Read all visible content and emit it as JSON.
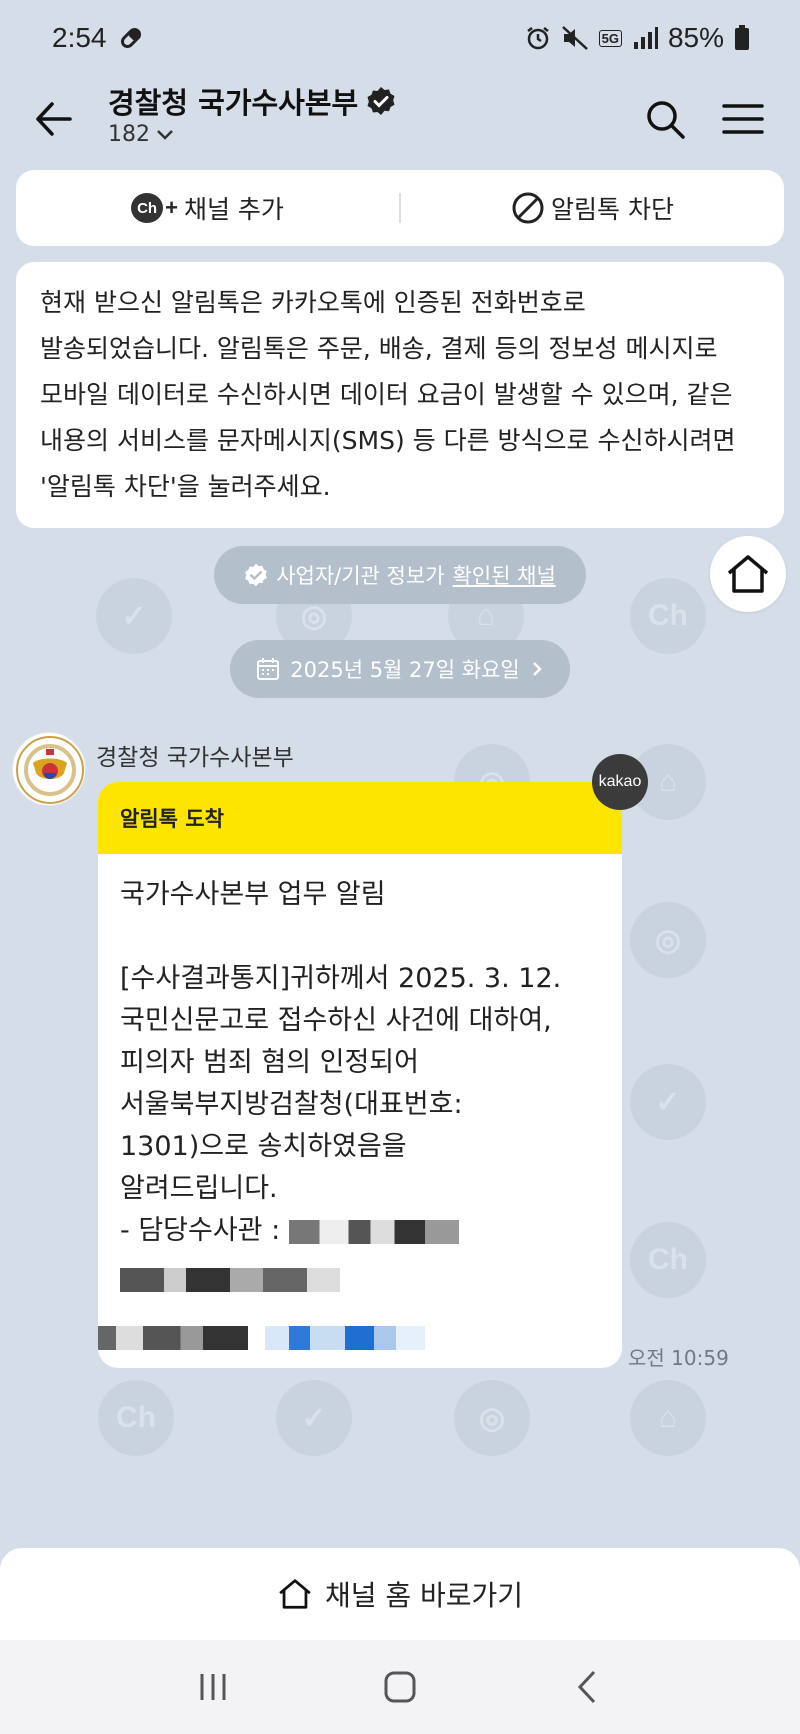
{
  "status_bar": {
    "time": "2:54",
    "battery": "85%",
    "network": "5G"
  },
  "header": {
    "title": "경찰청 국가수사본부",
    "subscriber_count": "182"
  },
  "actions": {
    "add_channel": "채널 추가",
    "add_channel_badge": "Ch",
    "block": "알림톡 차단"
  },
  "notice": {
    "text": "현재 받으신 알림톡은 카카오톡에 인증된 전화번호로 발송되었습니다. 알림톡은 주문, 배송, 결제 등의 정보성 메시지로 모바일 데이터로 수신하시면 데이터 요금이 발생할 수 있으며, 같은 내용의 서비스를 문자메시지(SMS) 등 다른 방식으로 수신하시려면 '알림톡 차단'을 눌러주세요."
  },
  "verified": {
    "prefix": "사업자/기관 정보가",
    "link": "확인된 채널"
  },
  "date_label": "2025년 5월 27일 화요일",
  "message": {
    "sender": "경찰청 국가수사본부",
    "header": "알림톡 도착",
    "badge": "kakao",
    "lines": [
      "국가수사본부 업무 알림",
      "",
      "[수사결과통지]귀하께서 2025. 3. 12.",
      "국민신문고로 접수하신 사건에 대하여,",
      "피의자 범죄 혐의 인정되어",
      "서울북부지방검찰청(대표번호:",
      "1301)으로 송치하였음을",
      "알려드립니다.",
      "- 담당수사관 : "
    ],
    "time": "오전 10:59"
  },
  "bottom": {
    "channel_home": "채널 홈 바로가기"
  },
  "colors": {
    "background": "#d4dde8",
    "kakao_yellow": "#fee500",
    "pill": "#b4bfcc"
  }
}
